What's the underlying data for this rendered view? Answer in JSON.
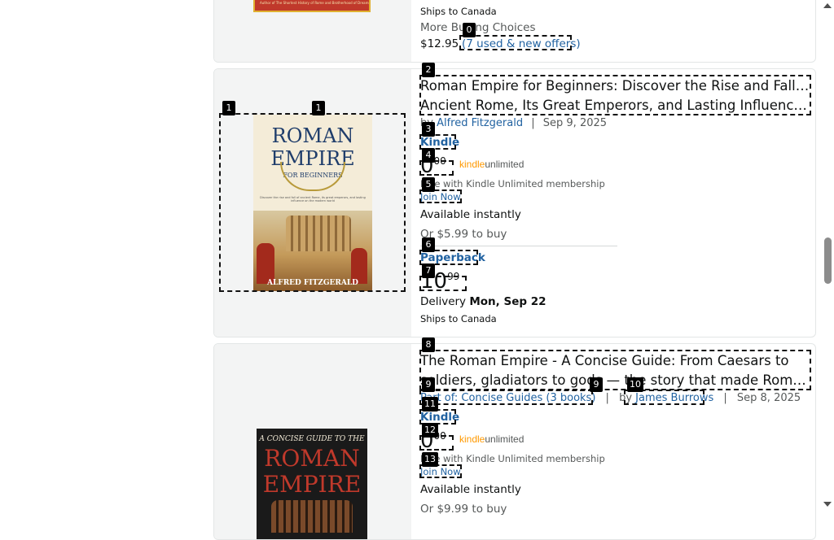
{
  "card0": {
    "ships": "Ships to Canada",
    "more_buying": "More Buying Choices",
    "price": "$12.95",
    "offers": "(7 used & new offers)",
    "cover_caption": "Author of The Shortest History of Rome and Brotherhood of Dreams"
  },
  "card1": {
    "title_line1": "Roman Empire for Beginners: Discover the Rise and Fall of",
    "title_line2": "Ancient Rome, Its Great Emperors, and Lasting Influence…",
    "by": "by",
    "author": "Alfred Fitzgerald",
    "sep": "|",
    "date": "Sep 9, 2025",
    "format_kindle": "Kindle",
    "kindle_price_whole": "0",
    "kindle_price_frac": "00",
    "ku_kindle": "kindle",
    "ku_unlimited": "unlimited",
    "ku_free": "Free with Kindle Unlimited membership",
    "join_now": "Join Now",
    "available": "Available instantly",
    "or_buy": "Or $5.99 to buy",
    "format_paperback": "Paperback",
    "paper_price_whole": "10",
    "paper_price_frac": "99",
    "delivery_label": "Delivery",
    "delivery_date": "Mon, Sep 22",
    "ships": "Ships to Canada",
    "cover": {
      "title1": "ROMAN",
      "title2": "EMPIRE",
      "subtitle": "FOR BEGINNERS",
      "blurb": "Discover the rise and fall of ancient Rome, its great emperors, and lasting influence on the modern world",
      "author": "ALFRED FITZGERALD"
    }
  },
  "card2": {
    "title_line1": "The Roman Empire - A Concise Guide: From Caesars to",
    "title_line2": "soldiers, gladiators to gods — the story that made Rom…",
    "series": "Part of: Concise Guides (3 books)",
    "by": "by",
    "author": "James Burrows",
    "sep": "|",
    "date": "Sep 8, 2025",
    "format_kindle": "Kindle",
    "kindle_price_whole": "0",
    "kindle_price_frac": "00",
    "ku_kindle": "kindle",
    "ku_unlimited": "unlimited",
    "ku_free": "Free with Kindle Unlimited membership",
    "join_now": "Join Now",
    "available": "Available instantly",
    "or_buy": "Or $9.99 to buy",
    "cover": {
      "line1": "A CONCISE GUIDE TO THE",
      "line2": "ROMAN",
      "line3": "EMPIRE"
    }
  },
  "markers": [
    "0",
    "1",
    "1",
    "2",
    "3",
    "4",
    "5",
    "6",
    "7",
    "8",
    "9",
    "9",
    "10",
    "11",
    "12",
    "13"
  ],
  "colors": {
    "link": "#2162a1",
    "ku_orange": "#ff9900",
    "cover_red": "#b5261e",
    "cover_cream": "#f4ecd8"
  }
}
